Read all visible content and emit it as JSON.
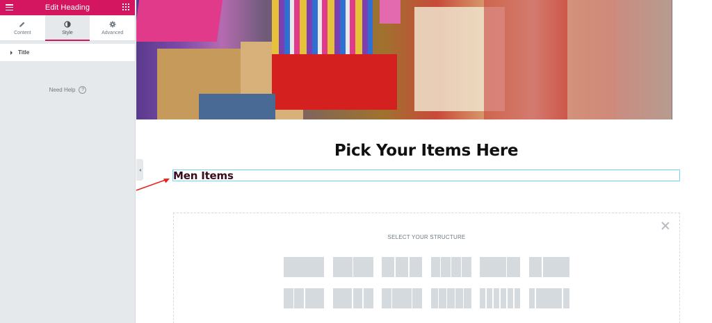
{
  "sidebar": {
    "title": "Edit Heading",
    "tabs": [
      {
        "label": "Content",
        "icon": "pencil-icon"
      },
      {
        "label": "Style",
        "icon": "contrast-icon"
      },
      {
        "label": "Advanced",
        "icon": "gear-icon"
      }
    ],
    "active_tab": "Style",
    "section_label": "Title",
    "help_label": "Need Help",
    "help_glyph": "?"
  },
  "canvas": {
    "page_title": "Pick Your Items Here",
    "selected_heading": "Men Items",
    "structure_title": "SELECT YOUR STRUCTURE",
    "structure_presets": [
      [
        100
      ],
      [
        50,
        50
      ],
      [
        33,
        33,
        33
      ],
      [
        25,
        25,
        25,
        25
      ],
      [
        66,
        33
      ],
      [
        33,
        66
      ],
      [
        25,
        25,
        50
      ],
      [
        50,
        25,
        25
      ],
      [
        25,
        50,
        25
      ],
      [
        20,
        20,
        20,
        20,
        20
      ],
      [
        16,
        16,
        16,
        16,
        16,
        16
      ],
      [
        16,
        66,
        16
      ]
    ]
  },
  "colors": {
    "accent": "#d3165f",
    "selection_outline": "#71d7f7",
    "annotation_arrow": "#e8221b"
  }
}
